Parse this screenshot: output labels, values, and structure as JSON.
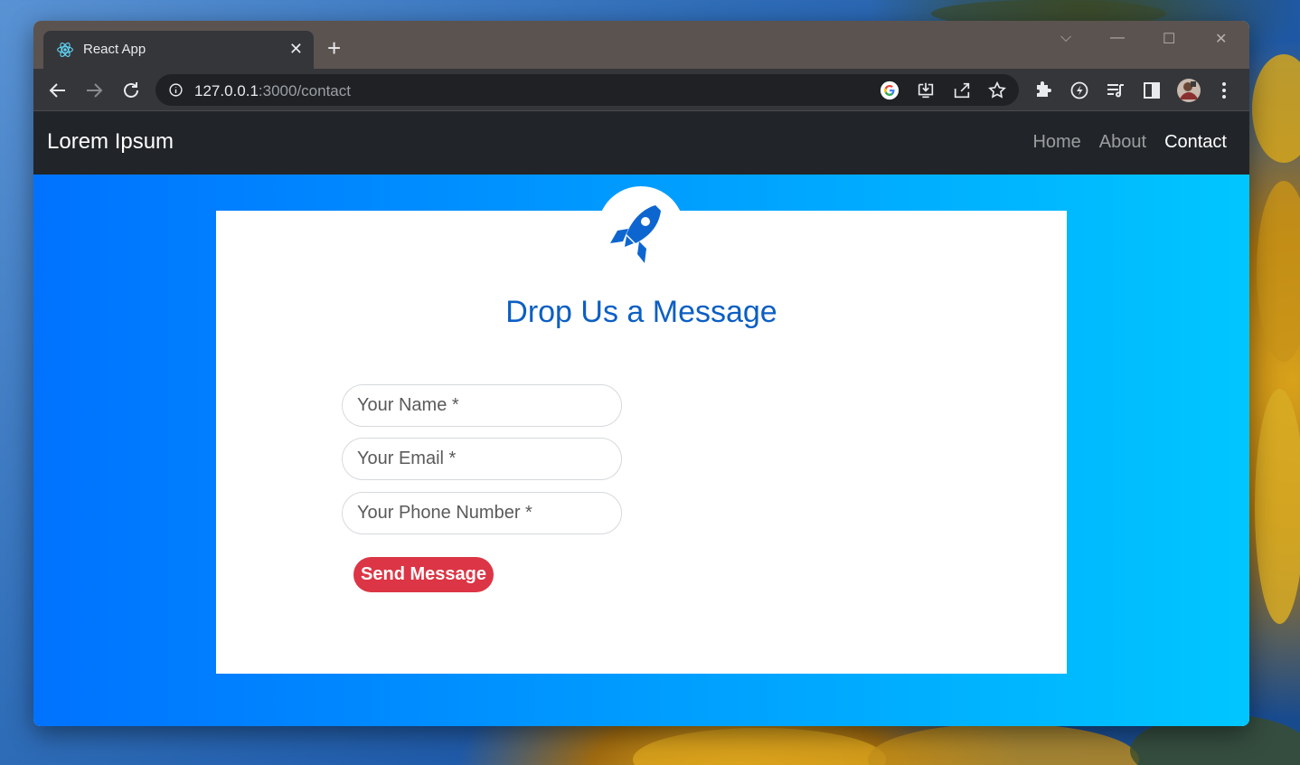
{
  "browser": {
    "tab_title": "React App",
    "tab_close_glyph": "✕",
    "new_tab_glyph": "+",
    "url_host": "127.0.0.1",
    "url_rest": ":3000/contact",
    "window_controls": {
      "dropdown": "⌵",
      "minimize": "—",
      "maximize": "☐",
      "close": "✕"
    }
  },
  "navbar": {
    "brand": "Lorem Ipsum",
    "links": [
      {
        "label": "Home",
        "active": false
      },
      {
        "label": "About",
        "active": false
      },
      {
        "label": "Contact",
        "active": true
      }
    ]
  },
  "form": {
    "heading": "Drop Us a Message",
    "name_placeholder": "Your Name *",
    "email_placeholder": "Your Email *",
    "phone_placeholder": "Your Phone Number *",
    "submit_label": "Send Message"
  },
  "colors": {
    "navbar_bg": "#212529",
    "gradient_start": "#0072ff",
    "gradient_end": "#00c6ff",
    "heading": "#0c5fc4",
    "button": "#dc3545"
  },
  "icons": [
    "react-favicon",
    "back-arrow-icon",
    "forward-arrow-icon",
    "reload-icon",
    "info-icon",
    "google-icon",
    "install-icon",
    "share-icon",
    "star-icon",
    "extensions-icon",
    "performance-icon",
    "media-icon",
    "sidepanel-icon",
    "profile-avatar",
    "menu-icon",
    "rocket-icon"
  ]
}
